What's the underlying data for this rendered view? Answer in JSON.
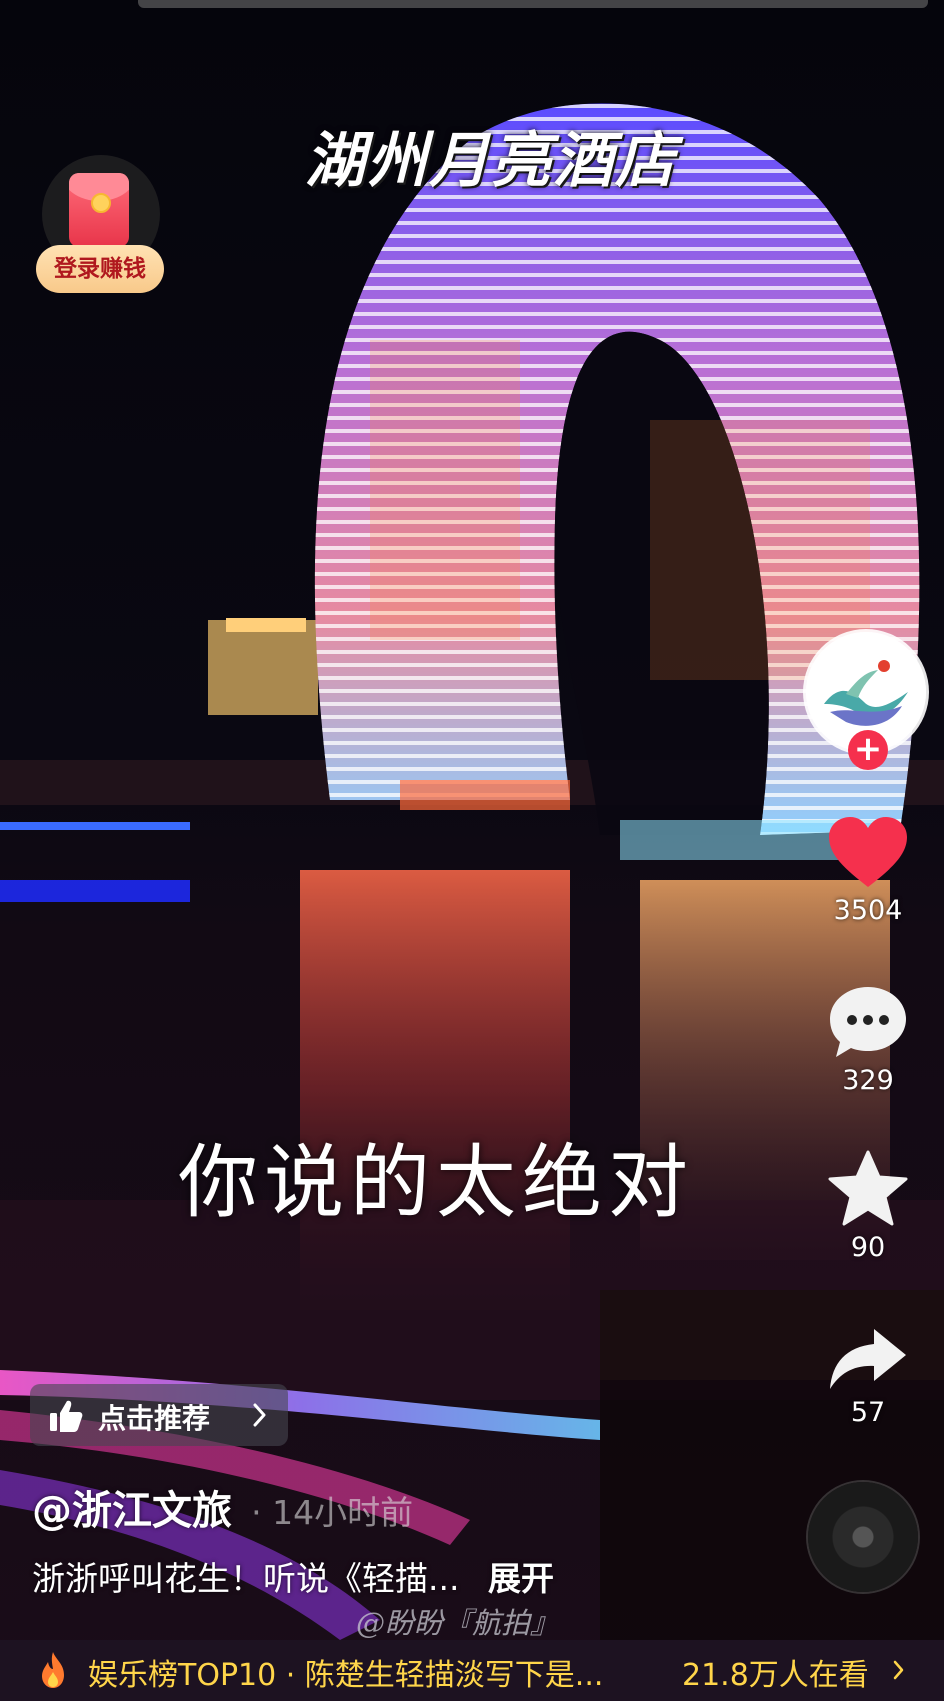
{
  "video": {
    "title_caption": "湖州月亮酒店",
    "subtitle_caption": "你说的太绝对",
    "watermark": "@盼盼『航拍』"
  },
  "login_promo": {
    "label": "登录赚钱"
  },
  "actions": {
    "likes": "3504",
    "comments": "329",
    "favorites": "90",
    "shares": "57"
  },
  "recommend": {
    "label": "点击推荐"
  },
  "post": {
    "author": "@浙江文旅",
    "time_ago": "· 14小时前",
    "description": "浙浙呼叫花生！听说《轻描...",
    "expand_label": "展开"
  },
  "trending": {
    "text": "娱乐榜TOP10 · 陈楚生轻描淡写下是...",
    "watchers": "21.8万人在看"
  },
  "colors": {
    "like_red": "#f5304d",
    "trend_yellow": "#ffd54a",
    "login_text": "#b0181e"
  },
  "icons": [
    "red-packet-icon",
    "plus-icon",
    "heart-icon",
    "comment-icon",
    "star-icon",
    "share-icon",
    "music-disc-icon",
    "thumbs-up-icon",
    "chevron-right-icon",
    "fire-icon"
  ]
}
